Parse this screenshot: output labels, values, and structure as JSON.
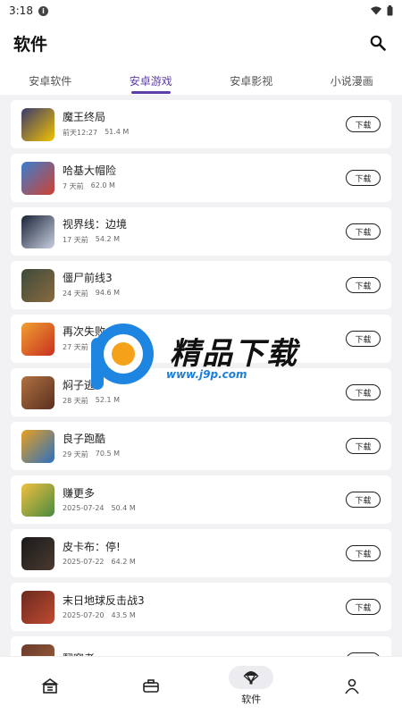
{
  "status_bar": {
    "time": "3:18",
    "info": "i"
  },
  "app_bar": {
    "title": "软件"
  },
  "tabs": [
    {
      "label": "安卓软件",
      "active": false
    },
    {
      "label": "安卓游戏",
      "active": true
    },
    {
      "label": "安卓影视",
      "active": false
    },
    {
      "label": "小说漫画",
      "active": false
    }
  ],
  "items": [
    {
      "name": "魔王终局",
      "date": "前天12:27",
      "size": "51.4 M",
      "colors": [
        "#3a3a6e",
        "#f2c200"
      ]
    },
    {
      "name": "哈基大帽险",
      "date": "7 天前",
      "size": "62.0 M",
      "colors": [
        "#3a7fd0",
        "#d04030"
      ]
    },
    {
      "name": "视界线：边境",
      "date": "17 天前",
      "size": "54.2 M",
      "colors": [
        "#1a2238",
        "#c8d0e0"
      ]
    },
    {
      "name": "僵尸前线3",
      "date": "24 天前",
      "size": "94.6 M",
      "colors": [
        "#3c4a3a",
        "#8a6a40"
      ]
    },
    {
      "name": "再次失败",
      "date": "27 天前",
      "size": "",
      "colors": [
        "#f0a030",
        "#c83020"
      ]
    },
    {
      "name": "焖子逃",
      "date": "28 天前",
      "size": "52.1 M",
      "colors": [
        "#b07040",
        "#5a3020"
      ]
    },
    {
      "name": "良子跑酷",
      "date": "29 天前",
      "size": "70.5 M",
      "colors": [
        "#e8a020",
        "#2a70c0"
      ]
    },
    {
      "name": "赚更多",
      "date": "2025-07-24",
      "size": "50.4 M",
      "colors": [
        "#f0c040",
        "#4a8a40"
      ]
    },
    {
      "name": "皮卡布：停!",
      "date": "2025-07-22",
      "size": "64.2 M",
      "colors": [
        "#1a1a1a",
        "#4a3a30"
      ]
    },
    {
      "name": "末日地球反击战3",
      "date": "2025-07-20",
      "size": "43.5 M",
      "colors": [
        "#6a2a20",
        "#c04a30"
      ]
    },
    {
      "name": "翻窗者",
      "date": "",
      "size": "",
      "colors": [
        "#6a3a2a",
        "#a06040"
      ]
    }
  ],
  "download_label": "下载",
  "watermark": {
    "brand": "精品下载",
    "url": "www.j9p.com"
  },
  "bottom_nav": [
    {
      "icon": "store-icon",
      "label": "",
      "active": false
    },
    {
      "icon": "toolbox-icon",
      "label": "",
      "active": false
    },
    {
      "icon": "parachute-icon",
      "label": "软件",
      "active": true
    },
    {
      "icon": "person-icon",
      "label": "",
      "active": false
    }
  ]
}
